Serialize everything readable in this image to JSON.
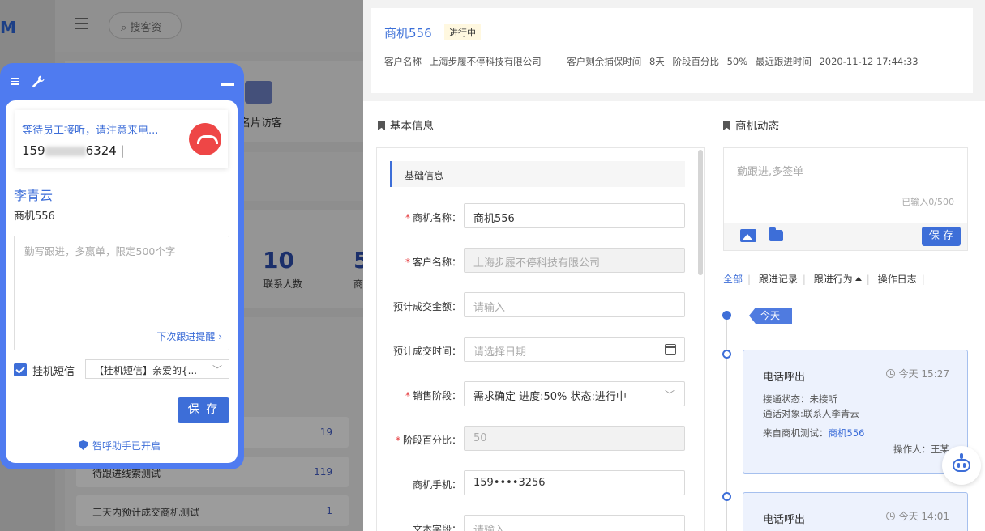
{
  "background": {
    "logo": "M",
    "search_placeholder": "搜客资",
    "visit_label": "名片访客",
    "stat_value": "10",
    "stat_label": "联系人数",
    "stat2_value": "5",
    "stat2_label": "商",
    "rows": [
      {
        "label": "",
        "count": "19"
      },
      {
        "label": "待跟进线索测试",
        "count": "119"
      },
      {
        "label": "三天内预计成交商机测试",
        "count": "1"
      }
    ]
  },
  "header": {
    "title": "商机556",
    "status": "进行中",
    "customer_label": "客户名称",
    "customer_value": "上海步履不停科技有限公司",
    "days_label": "客户剩余捕保时间",
    "days_value": "8天",
    "percent_label": "阶段百分比",
    "percent_value": "50%",
    "last_follow_label": "最近跟进时间",
    "last_follow_value": "2020-11-12 17:44:33"
  },
  "basic_info": {
    "section_title": "基本信息",
    "subhead": "基础信息",
    "fields": [
      {
        "label": "商机名称：",
        "required": true,
        "value": "商机556",
        "state": "normal"
      },
      {
        "label": "客户名称：",
        "required": true,
        "value": "上海步履不停科技有限公司",
        "state": "disabled"
      },
      {
        "label": "预计成交金额：",
        "required": false,
        "value": "请输入",
        "state": "placeholder"
      },
      {
        "label": "预计成交时间：",
        "required": false,
        "value": "请选择日期",
        "state": "placeholder"
      },
      {
        "label": "销售阶段：",
        "required": true,
        "value": "需求确定 进度:50% 状态:进行中",
        "state": "normal"
      },
      {
        "label": "阶段百分比：",
        "required": true,
        "value": "50",
        "state": "disabled"
      },
      {
        "label": "商机手机：",
        "required": false,
        "value": "159••••3256",
        "state": "normal"
      },
      {
        "label": "文本字段：",
        "required": false,
        "value": "请输入",
        "state": "placeholder"
      }
    ]
  },
  "dynamics": {
    "section_title": "商机动态",
    "placeholder": "勤跟进,多签单",
    "count": "已输入0/500",
    "save_label": "保 存",
    "tabs": [
      "全部",
      "跟进记录",
      "跟进行为",
      "操作日志"
    ],
    "today_tag": "今天",
    "cards": [
      {
        "title": "电话呼出",
        "time": "今天 15:27",
        "status": "接通状态：未接听",
        "target": "通话对象:联系人李青云",
        "source_label": "来自商机测试：",
        "source_link": "商机556",
        "operator": "操作人：王某"
      },
      {
        "title": "电话呼出",
        "time": "今天 14:01"
      }
    ]
  },
  "widget": {
    "call_status": "等待员工接听，请注意来电...",
    "number_start": "159",
    "number_end": "6324",
    "contact_name": "李青云",
    "opportunity": "商机556",
    "textarea_placeholder": "勤写跟进，多赢单，限定500个字",
    "reminder": "下次跟进提醒 ›",
    "sms_label": "挂机短信",
    "sms_value": "【挂机短信】亲爱的{...",
    "save_label": "保 存",
    "assistant": "智呼助手已开启"
  }
}
